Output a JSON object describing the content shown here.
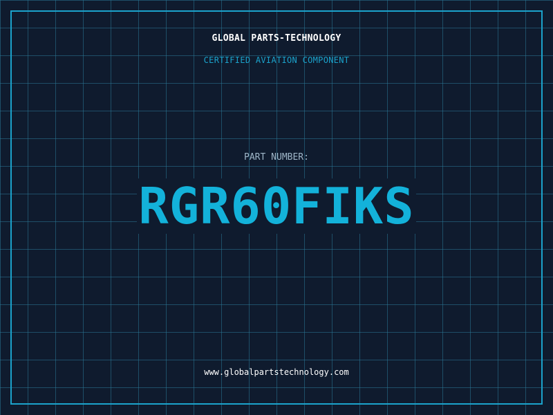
{
  "header": {
    "company": "GLOBAL PARTS-TECHNOLOGY",
    "tagline": "CERTIFIED AVIATION COMPONENT"
  },
  "part": {
    "label": "PART NUMBER:",
    "number": "RGR60FIKS"
  },
  "footer": {
    "website": "www.globalpartstechnology.com"
  },
  "colors": {
    "background": "#0f1b2e",
    "accent": "#1ba3cc",
    "part_number": "#13b2da",
    "label": "#9fb6c8",
    "text": "#ffffff"
  }
}
